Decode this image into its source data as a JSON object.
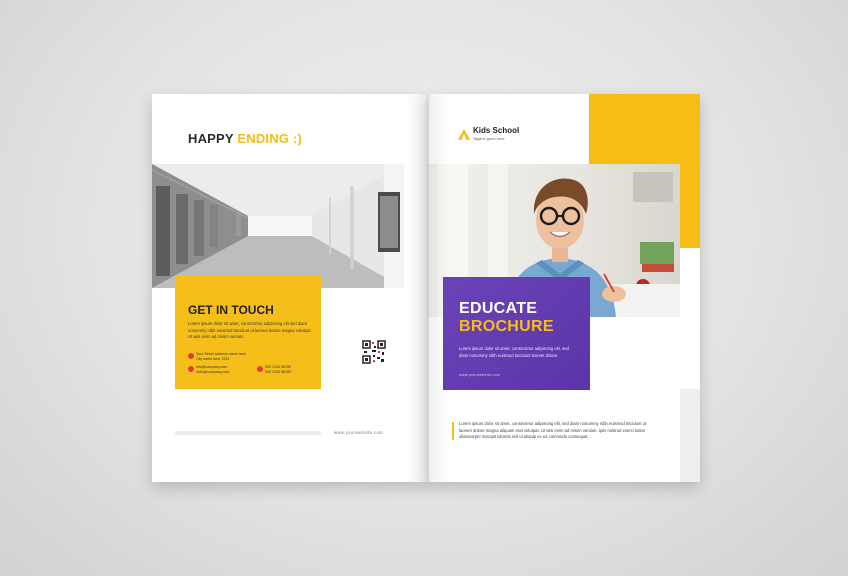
{
  "left_page": {
    "title_main": "HAPPY ",
    "title_accent": "ENDING :)",
    "contact": {
      "heading": "GET IN TOUCH",
      "body": "Lorem ipsum dolor sit amet, consectetur adipiscing elit sed diam nonummy nibh euismod tincidunt ut laoreet dolore magna volutpat. Ut wisi enim ad minim veniam.",
      "address_line1": "Your Street address name here",
      "address_line2": "City name here 1234",
      "email_line1": "info@company.com",
      "email_line2": "hello@company.com",
      "phone_line1": "000 1234 56789",
      "phone_line2": "000 1234 56789"
    },
    "footer_url": "www.yourwebsite.com"
  },
  "right_page": {
    "logo_name": "Kids School",
    "logo_tagline": "Tagline goes here",
    "brochure_line1": "EDUCATE",
    "brochure_line2": "BROCHURE",
    "brochure_body": "Lorem ipsum dolor sit amet, consectetur adipiscing elit, sed diam nonummy nibh euismod tincidunt laoreet dolore.",
    "brochure_url": "www.yourwebsite.com",
    "body_text": "Lorem ipsum dolor sit amet, consectetur adipiscing elit, sed diam nonummy nibh euismod tincidunt ut laoreet dolore magna aliquam erat volutpat. Ut wisi enim ad minim veniam, quis nostrud exerci tation ullamcorper suscipit lobortis nisl ut aliquip ex ea commodo consequat."
  },
  "colors": {
    "accent_yellow": "#f6bd14",
    "purple": "#5b35a8",
    "dark_text": "#2b2b2b"
  },
  "icons": [
    "location-pin-icon",
    "mail-icon",
    "phone-icon",
    "qr-code-icon",
    "triangle-logo-icon"
  ]
}
